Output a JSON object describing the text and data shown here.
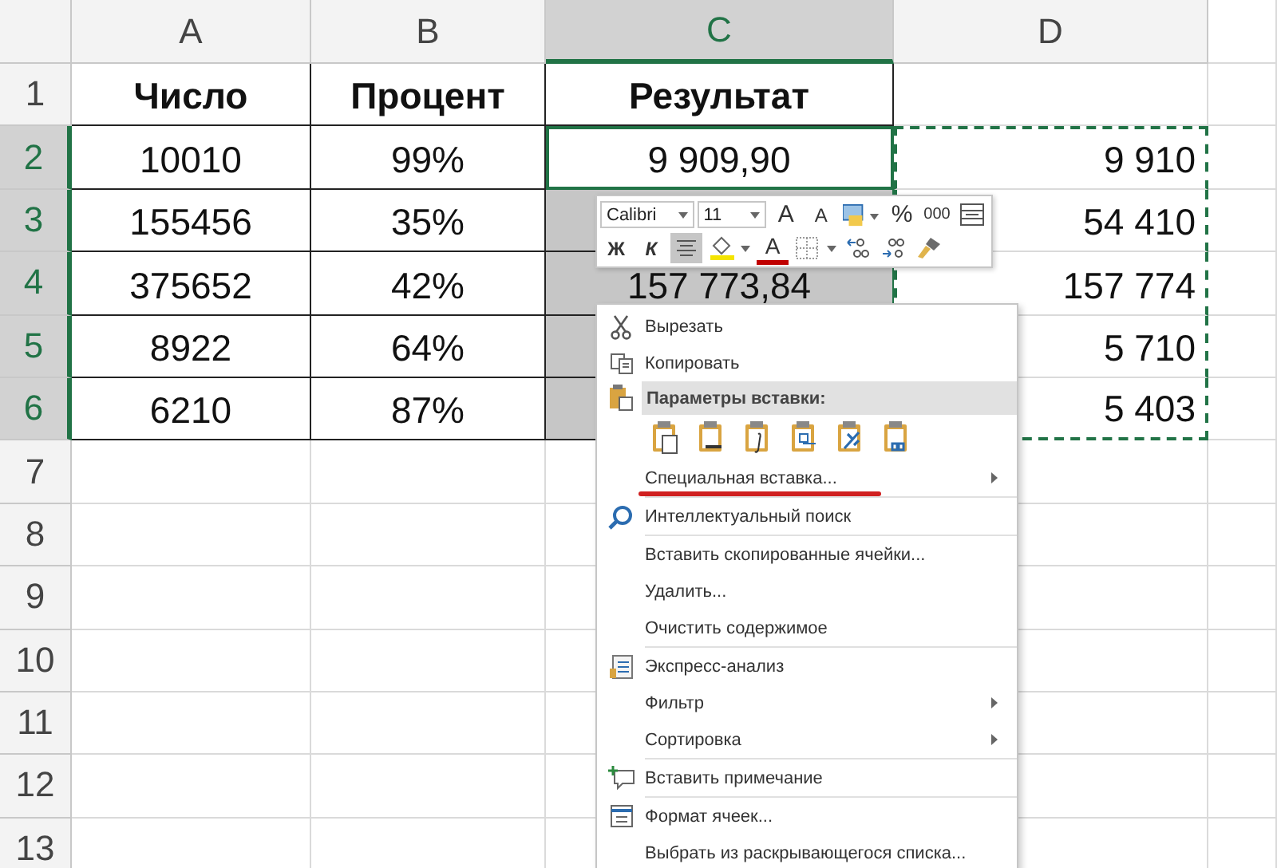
{
  "sheet": {
    "columns": [
      {
        "label": "A",
        "selected": false
      },
      {
        "label": "B",
        "selected": false
      },
      {
        "label": "C",
        "selected": true
      },
      {
        "label": "D",
        "selected": false
      }
    ],
    "rows": [
      {
        "number": "1",
        "selected": false,
        "kind": "header",
        "cells": [
          {
            "text": "Число",
            "selected": false,
            "active": false,
            "copied": false
          },
          {
            "text": "Процент",
            "selected": false,
            "active": false,
            "copied": false
          },
          {
            "text": "Результат",
            "selected": false,
            "active": false,
            "copied": false
          }
        ]
      },
      {
        "number": "2",
        "selected": true,
        "kind": "data",
        "cells": [
          {
            "text": "10010",
            "selected": false,
            "active": false,
            "copied": false
          },
          {
            "text": "99%",
            "selected": false,
            "active": false,
            "copied": false
          },
          {
            "text": "9 909,90",
            "selected": true,
            "active": true,
            "copied": false
          },
          {
            "text": "9 910",
            "selected": false,
            "active": false,
            "copied": true
          }
        ]
      },
      {
        "number": "3",
        "selected": true,
        "kind": "data",
        "cells": [
          {
            "text": "155456",
            "selected": false,
            "active": false,
            "copied": false
          },
          {
            "text": "35%",
            "selected": false,
            "active": false,
            "copied": false
          },
          {
            "selected": true,
            "active": false,
            "copied": false
          },
          {
            "text": "54 410",
            "selected": false,
            "active": false,
            "copied": true
          }
        ]
      },
      {
        "number": "4",
        "selected": true,
        "kind": "data",
        "cells": [
          {
            "text": "375652",
            "selected": false,
            "active": false,
            "copied": false
          },
          {
            "text": "42%",
            "selected": false,
            "active": false,
            "copied": false
          },
          {
            "text": "157 773,84",
            "selected": true,
            "active": false,
            "copied": false
          },
          {
            "text": "157 774",
            "selected": false,
            "active": false,
            "copied": true
          }
        ]
      },
      {
        "number": "5",
        "selected": true,
        "kind": "data",
        "cells": [
          {
            "text": "8922",
            "selected": false,
            "active": false,
            "copied": false
          },
          {
            "text": "64%",
            "selected": false,
            "active": false,
            "copied": false
          },
          {
            "selected": true,
            "active": false,
            "copied": false
          },
          {
            "text": "5 710",
            "selected": false,
            "active": false,
            "copied": true
          }
        ]
      },
      {
        "number": "6",
        "selected": true,
        "kind": "data",
        "cells": [
          {
            "text": "6210",
            "selected": false,
            "active": false,
            "copied": false
          },
          {
            "text": "87%",
            "selected": false,
            "active": false,
            "copied": false
          },
          {
            "selected": true,
            "active": false,
            "copied": false
          },
          {
            "text": "5 403",
            "selected": false,
            "active": false,
            "copied": true
          }
        ]
      },
      {
        "number": "7",
        "selected": false,
        "kind": "empty"
      },
      {
        "number": "8",
        "selected": false,
        "kind": "empty"
      },
      {
        "number": "9",
        "selected": false,
        "kind": "empty"
      },
      {
        "number": "10",
        "selected": false,
        "kind": "empty"
      },
      {
        "number": "11",
        "selected": false,
        "kind": "empty"
      },
      {
        "number": "12",
        "selected": false,
        "kind": "empty"
      },
      {
        "number": "13",
        "selected": false,
        "kind": "empty"
      }
    ]
  },
  "mini_toolbar": {
    "upper": [
      {
        "kind": "dropdown",
        "value": "Calibri",
        "selected": false
      },
      {
        "kind": "dropdown",
        "value": "11",
        "selected": false
      },
      {
        "kind": "grow-font",
        "label": "A",
        "selected": false
      },
      {
        "kind": "shrink-font",
        "label": "A",
        "selected": false
      },
      {
        "kind": "styles",
        "selected": false
      },
      {
        "kind": "text",
        "label": "%",
        "selected": false
      },
      {
        "kind": "text",
        "label": "000",
        "selected": false
      },
      {
        "kind": "merge",
        "selected": false
      }
    ],
    "lower": [
      {
        "kind": "bold",
        "label": "Ж",
        "selected": false
      },
      {
        "kind": "italic",
        "label": "К",
        "selected": false
      },
      {
        "kind": "align",
        "selected": true
      },
      {
        "kind": "fill",
        "selected": false
      },
      {
        "kind": "font-color",
        "label": "A",
        "selected": false
      },
      {
        "kind": "borders",
        "selected": false
      },
      {
        "kind": "inc-decimal",
        "selected": false
      },
      {
        "kind": "dec-decimal",
        "selected": false
      },
      {
        "kind": "painter",
        "selected": false
      }
    ]
  },
  "context_menu": {
    "items": [
      {
        "kind": "cut",
        "label": "Вырезать",
        "submenu": false,
        "marked": false
      },
      {
        "kind": "copy",
        "label": "Копировать",
        "submenu": false,
        "marked": false
      },
      {
        "kind": "paste-header",
        "label": "Параметры вставки:"
      },
      {
        "kind": "paste-options"
      },
      {
        "kind": "command",
        "label": "Специальная вставка...",
        "submenu": true,
        "marked": true
      },
      {
        "kind": "separator"
      },
      {
        "kind": "search",
        "label": "Интеллектуальный поиск",
        "submenu": false,
        "marked": false
      },
      {
        "kind": "separator"
      },
      {
        "kind": "command",
        "label": "Вставить скопированные ячейки...",
        "submenu": false,
        "marked": false
      },
      {
        "kind": "command",
        "label": "Удалить...",
        "submenu": false,
        "marked": false
      },
      {
        "kind": "command",
        "label": "Очистить содержимое",
        "submenu": false,
        "marked": false
      },
      {
        "kind": "separator"
      },
      {
        "kind": "quick-analysis",
        "label": "Экспресс-анализ",
        "submenu": false,
        "marked": false
      },
      {
        "kind": "command",
        "label": "Фильтр",
        "submenu": true,
        "marked": false
      },
      {
        "kind": "command",
        "label": "Сортировка",
        "submenu": true,
        "marked": false
      },
      {
        "kind": "separator"
      },
      {
        "kind": "comment",
        "label": "Вставить примечание",
        "submenu": false,
        "marked": false
      },
      {
        "kind": "separator"
      },
      {
        "kind": "format-cells",
        "label": "Формат ячеек...",
        "submenu": false,
        "marked": false
      },
      {
        "kind": "command",
        "label": "Выбрать из раскрывающегося списка...",
        "submenu": false,
        "marked": false
      }
    ]
  }
}
